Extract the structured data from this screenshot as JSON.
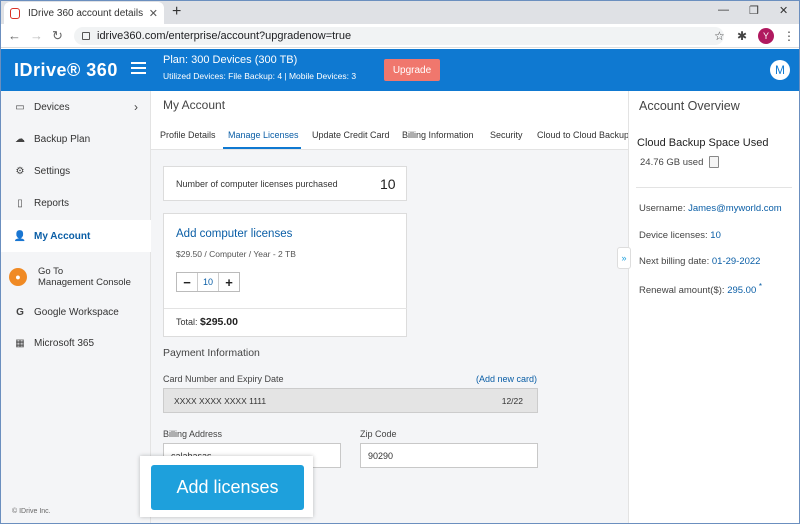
{
  "browser": {
    "tab_title": "IDrive 360 account details",
    "url": "idrive360.com/enterprise/account?upgradenow=true",
    "profile_initial": "Y"
  },
  "header": {
    "logo": "IDrive® 360",
    "plan": "Plan: 300 Devices (300 TB)",
    "usage": "Utilized Devices: File Backup: 4 | Mobile Devices: 3",
    "upgrade_label": "Upgrade",
    "user_initial": "M"
  },
  "sidebar": {
    "items": [
      {
        "label": "Devices",
        "icon": "devices-icon"
      },
      {
        "label": "Backup Plan",
        "icon": "cloud-icon"
      },
      {
        "label": "Settings",
        "icon": "gear-icon"
      },
      {
        "label": "Reports",
        "icon": "report-icon"
      },
      {
        "label": "My Account",
        "icon": "user-icon"
      }
    ],
    "goto_line1": "Go To",
    "goto_line2": "Management Console",
    "google": "Google Workspace",
    "microsoft": "Microsoft 365",
    "copyright": "© IDrive Inc."
  },
  "main": {
    "title": "My Account",
    "tabs": [
      "Profile Details",
      "Manage Licenses",
      "Update Credit Card",
      "Billing Information",
      "Security",
      "Cloud to Cloud Backup"
    ],
    "active_tab": "Manage Licenses",
    "licenses_label": "Number of computer licenses purchased",
    "licenses_value": "10",
    "add_title": "Add computer licenses",
    "price": "$29.50 / Computer / Year - 2 TB",
    "stepper_value": "10",
    "total_label": "Total:",
    "total_value": "$295.00",
    "payment_title": "Payment Information",
    "card_label": "Card Number and Expiry Date",
    "add_new_card": "(Add new card)",
    "card_number": "XXXX XXXX XXXX 1111",
    "card_expiry": "12/22",
    "billing_label": "Billing Address",
    "billing_value": "calabasas",
    "zip_label": "Zip Code",
    "zip_value": "90290",
    "add_button": "Add licenses"
  },
  "overview": {
    "title": "Account Overview",
    "cloud_title": "Cloud  Backup Space Used",
    "cloud_used": "24.76 GB used",
    "username_label": "Username:",
    "username_value": "James@myworld.com",
    "device_label": "Device licenses:",
    "device_value": "10",
    "billing_label": "Next billing date:",
    "billing_value": "01-29-2022",
    "renewal_label": "Renewal amount($):",
    "renewal_value": "295.00",
    "renewal_mark": "*"
  }
}
